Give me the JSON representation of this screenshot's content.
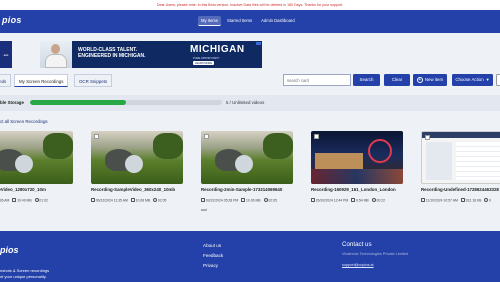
{
  "notice": "Dear Users, please note: In this Beta version, Inactive Data files will be deleted in 180 Days. Thanks for your support.",
  "brand": "pios",
  "topnav": [
    "My Items",
    "Starred Items",
    "Admin Dashboard"
  ],
  "ad": {
    "left_text": "ads",
    "headline": "WORLD-CLASS TALENT. ENGINEERED IN MICHIGAN.",
    "brand": "MICHIGAN",
    "subline": "PURE OPPORTUNITY",
    "cta": "LEARN MORE"
  },
  "tabs": [
    "nds",
    "My Screen Recordings",
    "OCR Snippets"
  ],
  "search": {
    "placeholder": "search card",
    "button": "Search",
    "clear": "Clear"
  },
  "new_item": "New item",
  "choose_action": "Choose Action",
  "storage": {
    "label": "ble Storage",
    "count_text": "5 / Unlimited videos",
    "progress": 0.5
  },
  "select_all": "ct all Screen Recordings",
  "cards": [
    {
      "title": "g-SampleVideo_1280x720_10m",
      "date": "/2024 11:36 AM",
      "size": "10.49 MB",
      "duration": "01:02",
      "thumb": "grass",
      "extra": ""
    },
    {
      "title": "Recording-SampleVideo_360x240_10mb",
      "date": "06/12/2024 11:35 AM",
      "size": "10.08 MB",
      "duration": "02:05",
      "thumb": "grass",
      "extra": ""
    },
    {
      "title": "Recording-2min-Sample-173314069640",
      "date": "03/12/2024 05:28 PM",
      "size": "10.06 MB",
      "duration": "02:05",
      "thumb": "grass",
      "extra": "aud"
    },
    {
      "title": "Recording-160929_161_London_London",
      "date": "26/10/2024 12:44 PM",
      "size": "6.54 MB",
      "duration": "00:22",
      "thumb": "night",
      "extra": ""
    },
    {
      "title": "Recording-Undefined-1728624463328",
      "date": "11/10/2024 10:57 AM",
      "size": "912.18 KB",
      "duration": "0",
      "thumb": "office",
      "extra": ""
    }
  ],
  "footer": {
    "brand": "pios",
    "tagline1": "nshots & Screen recordings",
    "tagline2": "of your unique personality.",
    "links": [
      "About us",
      "Feedback",
      "Privacy"
    ],
    "contact_title": "Contact us",
    "company": "Vivatriodc Technologies Private Limited",
    "email": "support@copios.ai"
  },
  "colors": {
    "primary": "#2341a8",
    "progress": "#28a745",
    "notice": "#cc2b2b"
  }
}
